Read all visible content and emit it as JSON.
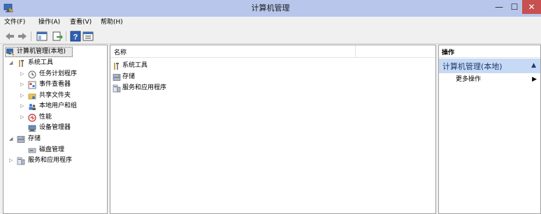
{
  "window": {
    "title": "计算机管理",
    "controls": {
      "minimize": "—",
      "maximize": "☐",
      "close": "✕"
    }
  },
  "menu": {
    "items": [
      {
        "label": "文件(F)"
      },
      {
        "label": "操作(A)"
      },
      {
        "label": "查看(V)"
      },
      {
        "label": "帮助(H)"
      }
    ]
  },
  "toolbar": {
    "icons": [
      "back-arrow-icon",
      "forward-arrow-icon",
      "show-hide-tree-icon",
      "export-list-icon",
      "help-icon",
      "properties-icon"
    ]
  },
  "tree": {
    "root": {
      "label": "计算机管理(本地)",
      "icon": "computer-management-icon"
    },
    "system_tools": {
      "label": "系统工具",
      "icon": "tools-icon",
      "children": [
        {
          "label": "任务计划程序",
          "icon": "clock-icon",
          "expandable": true
        },
        {
          "label": "事件查看器",
          "icon": "event-viewer-icon",
          "expandable": true
        },
        {
          "label": "共享文件夹",
          "icon": "shared-folder-icon",
          "expandable": true
        },
        {
          "label": "本地用户和组",
          "icon": "users-icon",
          "expandable": true
        },
        {
          "label": "性能",
          "icon": "performance-icon",
          "expandable": true
        },
        {
          "label": "设备管理器",
          "icon": "device-manager-icon",
          "expandable": false
        }
      ]
    },
    "storage": {
      "label": "存储",
      "icon": "storage-icon",
      "children": [
        {
          "label": "磁盘管理",
          "icon": "disk-icon"
        }
      ]
    },
    "services": {
      "label": "服务和应用程序",
      "icon": "services-icon"
    }
  },
  "list": {
    "column_name": "名称",
    "items": [
      {
        "label": "系统工具",
        "icon": "tools-icon"
      },
      {
        "label": "存储",
        "icon": "storage-icon"
      },
      {
        "label": "服务和应用程序",
        "icon": "services-icon"
      }
    ]
  },
  "actions": {
    "header": "操作",
    "section_title": "计算机管理(本地)",
    "more": "更多操作"
  }
}
